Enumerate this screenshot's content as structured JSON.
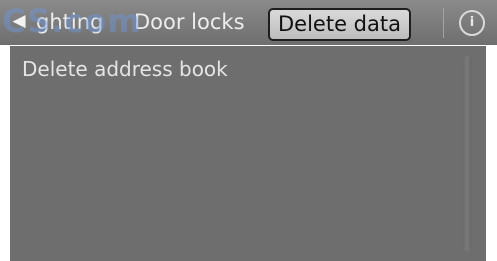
{
  "tabs": {
    "prev_arrow_icon": "left-arrow-icon",
    "items": [
      {
        "label": "ghting"
      },
      {
        "label": "Door locks"
      },
      {
        "label": "Delete data",
        "selected": true
      }
    ],
    "info_icon": "info-icon",
    "info_glyph": "i"
  },
  "content": {
    "items": [
      {
        "label": "Delete address book"
      }
    ]
  },
  "watermark": {
    "text": "CS.com"
  }
}
